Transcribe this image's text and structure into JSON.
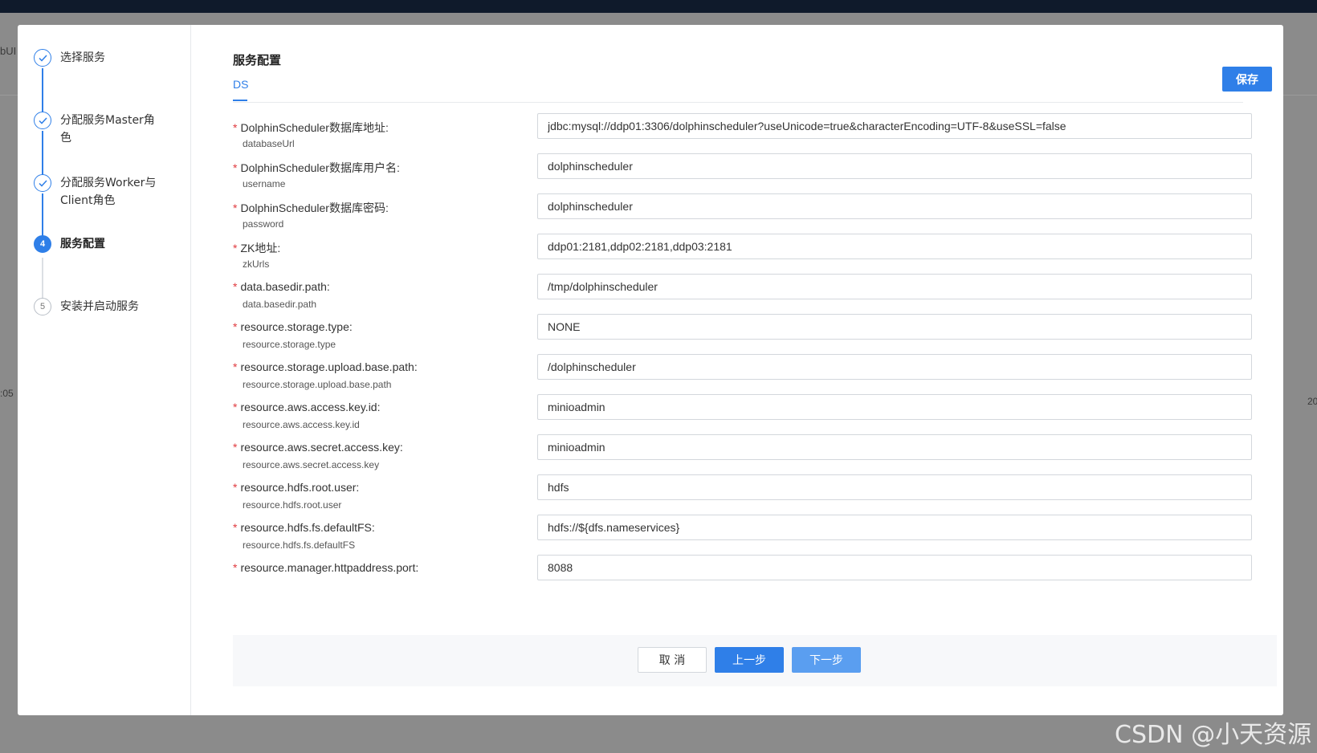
{
  "background": {
    "fragments": [
      "bUI",
      ":05",
      "20"
    ]
  },
  "steps": [
    {
      "label": "选择服务",
      "state": "done"
    },
    {
      "label": "分配服务Master角色",
      "state": "done"
    },
    {
      "label": "分配服务Worker与Client角色",
      "state": "done"
    },
    {
      "label": "服务配置",
      "state": "active",
      "number": "4"
    },
    {
      "label": "安装并启动服务",
      "state": "pending",
      "number": "5"
    }
  ],
  "content": {
    "title": "服务配置",
    "tab": "DS",
    "save_label": "保存"
  },
  "fields": [
    {
      "label": "DolphinScheduler数据库地址:",
      "key": "databaseUrl",
      "value": "jdbc:mysql://ddp01:3306/dolphinscheduler?useUnicode=true&characterEncoding=UTF-8&useSSL=false"
    },
    {
      "label": "DolphinScheduler数据库用户名:",
      "key": "username",
      "value": "dolphinscheduler"
    },
    {
      "label": "DolphinScheduler数据库密码:",
      "key": "password",
      "value": "dolphinscheduler"
    },
    {
      "label": "ZK地址:",
      "key": "zkUrls",
      "value": "ddp01:2181,ddp02:2181,ddp03:2181"
    },
    {
      "label": "data.basedir.path:",
      "key": "data.basedir.path",
      "value": "/tmp/dolphinscheduler"
    },
    {
      "label": "resource.storage.type:",
      "key": "resource.storage.type",
      "value": "NONE"
    },
    {
      "label": "resource.storage.upload.base.path:",
      "key": "resource.storage.upload.base.path",
      "value": "/dolphinscheduler"
    },
    {
      "label": "resource.aws.access.key.id:",
      "key": "resource.aws.access.key.id",
      "value": "minioadmin"
    },
    {
      "label": "resource.aws.secret.access.key:",
      "key": "resource.aws.secret.access.key",
      "value": "minioadmin"
    },
    {
      "label": "resource.hdfs.root.user:",
      "key": "resource.hdfs.root.user",
      "value": "hdfs"
    },
    {
      "label": "resource.hdfs.fs.defaultFS:",
      "key": "resource.hdfs.fs.defaultFS",
      "value": "hdfs://${dfs.nameservices}"
    },
    {
      "label": "resource.manager.httpaddress.port:",
      "key": "",
      "value": "8088"
    }
  ],
  "footer": {
    "cancel_label": "取 消",
    "prev_label": "上一步",
    "next_label": "下一步"
  },
  "watermark": "CSDN @小天资源",
  "colors": {
    "accent": "#2f7fe8",
    "accent_light": "#5a9ef0",
    "required": "#e0393e"
  }
}
